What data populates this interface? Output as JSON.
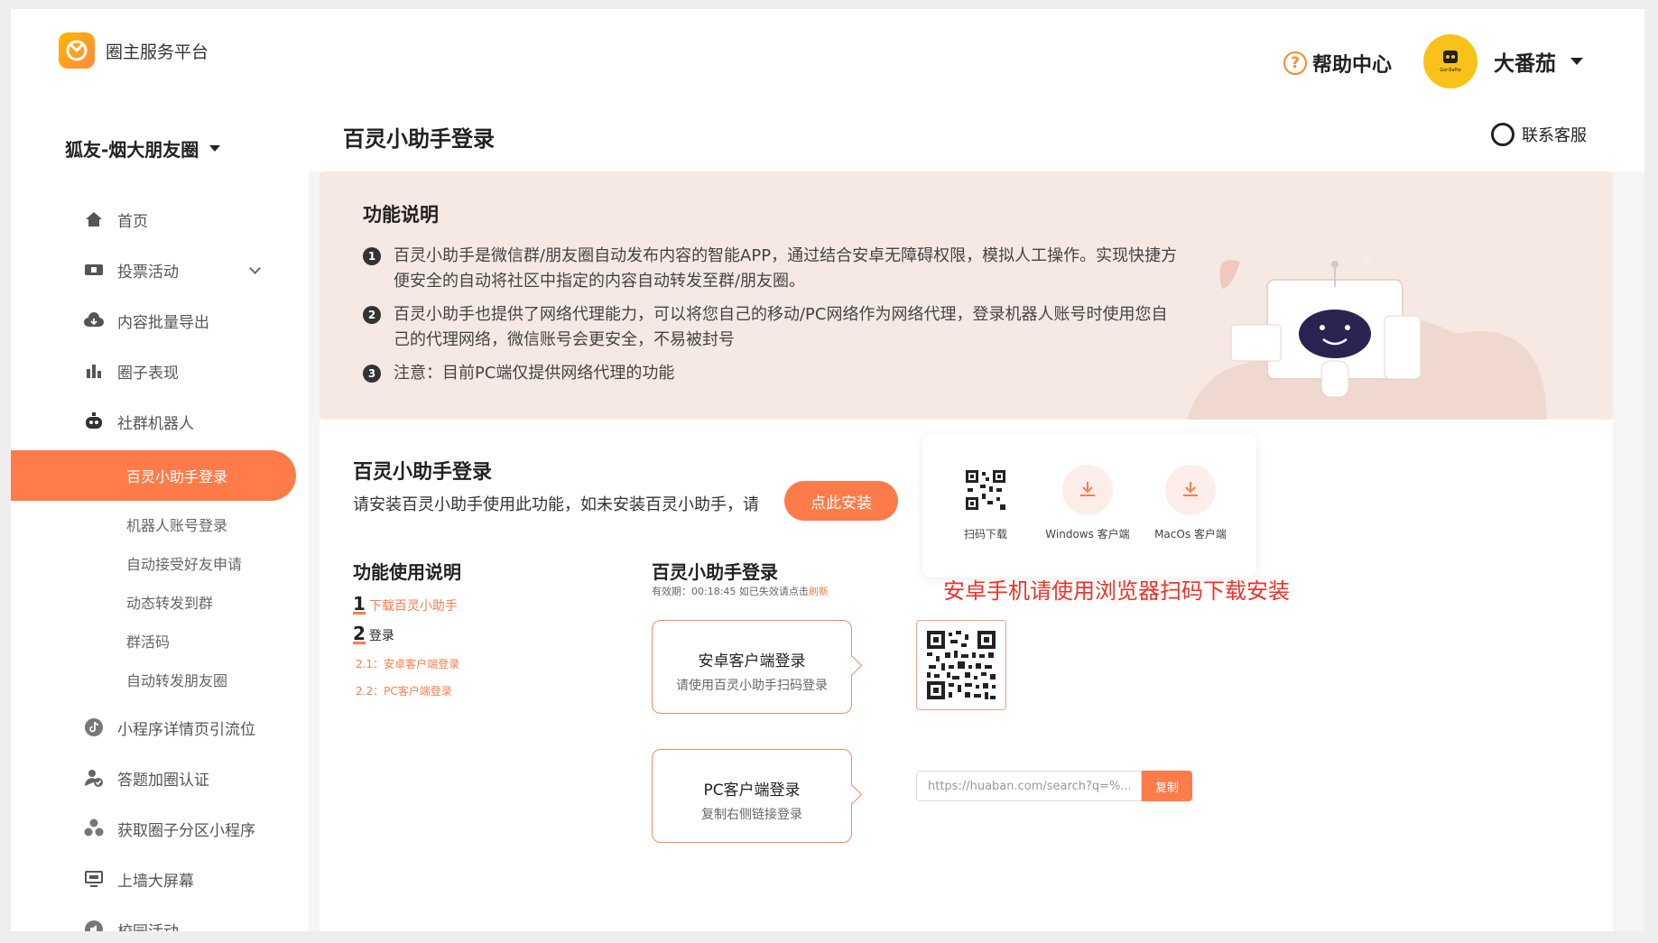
{
  "app": {
    "logo_text": "圈主服务平台"
  },
  "circle": {
    "name": "狐友-烟大朋友圈"
  },
  "header": {
    "help_label": "帮助中心",
    "username": "大番茄",
    "avatar_text": "GorillaPie"
  },
  "page": {
    "title": "百灵小助手登录",
    "service_label": "联系客服"
  },
  "sidebar": {
    "items": [
      {
        "label": "首页",
        "icon": "home-icon"
      },
      {
        "label": "投票活动",
        "icon": "ticket-icon"
      },
      {
        "label": "内容批量导出",
        "icon": "cloud-icon"
      },
      {
        "label": "圈子表现",
        "icon": "bar-chart-icon"
      },
      {
        "label": "社群机器人",
        "icon": "robot-icon"
      }
    ],
    "subitems": [
      "百灵小助手登录",
      "机器人账号登录",
      "自动接受好友申请",
      "动态转发到群",
      "群活码",
      "自动转发朋友圈"
    ],
    "bottom_items": [
      {
        "label": "小程序详情页引流位",
        "icon": "tiktok-icon"
      },
      {
        "label": "答题加圈认证",
        "icon": "user-check-icon"
      },
      {
        "label": "获取圈子分区小程序",
        "icon": "group-icon"
      },
      {
        "label": "上墙大屏幕",
        "icon": "monitor-icon"
      },
      {
        "label": "校园活动",
        "icon": "speaker-icon"
      }
    ]
  },
  "feature": {
    "title": "功能说明",
    "lines": [
      "百灵小助手是微信群/朋友圈自动发布内容的智能APP，通过结合安卓无障碍权限，模拟人工操作。实现快捷方便安全的自动将社区中指定的内容自动转发至群/朋友圈。",
      "百灵小助手也提供了网络代理能力，可以将您自己的移动/PC网络作为网络代理，登录机器人账号时使用您自己的代理网络，微信账号会更安全，不易被封号",
      "注意：目前PC端仅提供网络代理的功能"
    ],
    "nums": [
      "1",
      "2",
      "3"
    ]
  },
  "install": {
    "title": "百灵小助手登录",
    "text": "请安装百灵小助手使用此功能，如未安装百灵小助手，请",
    "button": "点此安装"
  },
  "downloads": {
    "scan": "扫码下载",
    "windows": "Windows 客户端",
    "mac": "MacOs 客户端"
  },
  "red_note": "安卓手机请使用浏览器扫码下载安装",
  "usage": {
    "title": "功能使用说明",
    "step1_num": "1",
    "step1": "下载百灵小助手",
    "step2_num": "2",
    "step2": "登录",
    "sub1": "2.1：安卓客户端登录",
    "sub2": "2.2：PC客户端登录"
  },
  "login": {
    "title": "百灵小助手登录",
    "validity_prefix": "有效期：00:18:45 如已失效请点击",
    "refresh": "刷新",
    "android_title": "安卓客户端登录",
    "android_desc": "请使用百灵小助手扫码登录",
    "pc_title": "PC客户端登录",
    "pc_desc": "复制右侧链接登录",
    "link_value": "https://huaban.com/search?q=%...",
    "copy": "复制"
  },
  "colors": {
    "accent": "#ff7b4a",
    "warning": "#f0322a",
    "feature_bg": "#f6e9e4"
  }
}
